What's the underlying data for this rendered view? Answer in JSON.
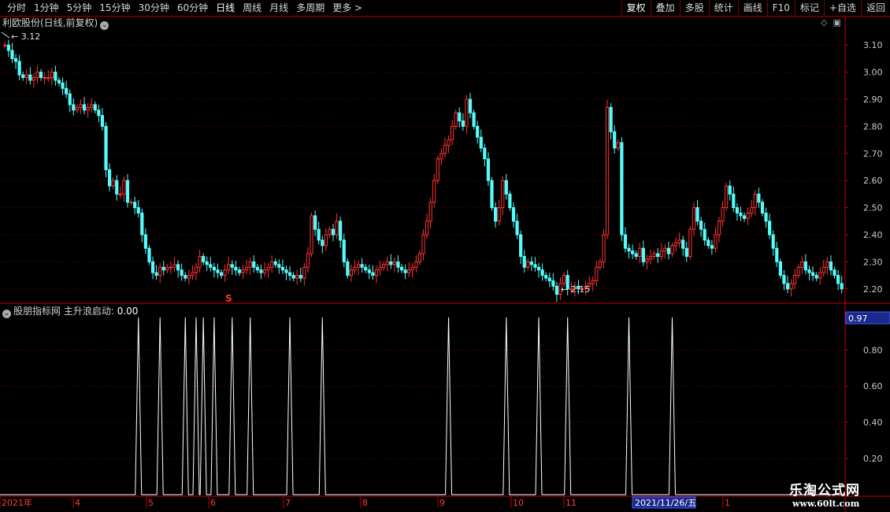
{
  "toolbar": {
    "periods": [
      "分时",
      "1分钟",
      "5分钟",
      "15分钟",
      "30分钟",
      "60分钟",
      "日线",
      "周线",
      "月线",
      "多周期",
      "更多 >"
    ],
    "active_period": "日线",
    "actions": [
      "复权",
      "叠加",
      "多股",
      "统计",
      "画线",
      "F10",
      "标记",
      "+自选",
      "返回"
    ]
  },
  "stock": {
    "title": "利欧股份(日线,前复权)"
  },
  "price_axis": {
    "labels": [
      "3.10",
      "3.00",
      "2.90",
      "2.80",
      "2.70",
      "2.60",
      "2.50",
      "2.40",
      "2.30",
      "2.20"
    ]
  },
  "annotations": {
    "high": "3.12",
    "low": "2.15",
    "signal": "S"
  },
  "indicator": {
    "title": "股朋指标网 主升浪启动:",
    "value": "0.00",
    "current": "0.97",
    "axis_labels": [
      "0.80",
      "0.60",
      "0.40",
      "0.20"
    ]
  },
  "date_axis": {
    "labels": [
      "2021年",
      "4",
      "5",
      "6",
      "7",
      "8",
      "9",
      "10",
      "11",
      "1"
    ],
    "cursor": "2021/11/26/五"
  },
  "watermark": {
    "name": "乐淘公式网",
    "url": "www.60lt.com"
  },
  "colors": {
    "up": "#ff3232",
    "down": "#54fcfc",
    "grid": "#7a0000",
    "axis": "#c00000",
    "line": "#ffffff"
  },
  "chart_data": {
    "type": "candlestick",
    "ylim": [
      2.15,
      3.15
    ],
    "y_ticks": [
      3.1,
      3.0,
      2.9,
      2.8,
      2.7,
      2.6,
      2.5,
      2.4,
      2.3,
      2.2
    ],
    "close": [
      3.1,
      3.08,
      3.05,
      3.04,
      2.99,
      2.98,
      2.99,
      2.97,
      2.98,
      3.0,
      2.98,
      2.98,
      2.98,
      3.0,
      2.97,
      2.96,
      2.94,
      2.92,
      2.88,
      2.86,
      2.87,
      2.88,
      2.86,
      2.87,
      2.88,
      2.86,
      2.84,
      2.8,
      2.64,
      2.58,
      2.6,
      2.55,
      2.55,
      2.6,
      2.52,
      2.52,
      2.5,
      2.48,
      2.4,
      2.35,
      2.3,
      2.26,
      2.25,
      2.28,
      2.27,
      2.28,
      2.28,
      2.29,
      2.27,
      2.25,
      2.24,
      2.25,
      2.26,
      2.28,
      2.32,
      2.3,
      2.29,
      2.28,
      2.27,
      2.26,
      2.25,
      2.27,
      2.29,
      2.28,
      2.27,
      2.26,
      2.27,
      2.28,
      2.3,
      2.28,
      2.27,
      2.26,
      2.27,
      2.28,
      2.3,
      2.29,
      2.28,
      2.27,
      2.26,
      2.25,
      2.24,
      2.25,
      2.24,
      2.28,
      2.33,
      2.47,
      2.42,
      2.38,
      2.36,
      2.4,
      2.42,
      2.4,
      2.45,
      2.38,
      2.3,
      2.25,
      2.27,
      2.28,
      2.29,
      2.28,
      2.27,
      2.26,
      2.25,
      2.27,
      2.28,
      2.29,
      2.3,
      2.29,
      2.3,
      2.28,
      2.27,
      2.26,
      2.27,
      2.28,
      2.3,
      2.33,
      2.4,
      2.45,
      2.52,
      2.6,
      2.68,
      2.7,
      2.73,
      2.75,
      2.8,
      2.85,
      2.82,
      2.8,
      2.9,
      2.85,
      2.8,
      2.76,
      2.72,
      2.68,
      2.6,
      2.5,
      2.45,
      2.5,
      2.6,
      2.55,
      2.5,
      2.45,
      2.4,
      2.32,
      2.28,
      2.3,
      2.29,
      2.28,
      2.27,
      2.25,
      2.24,
      2.23,
      2.21,
      2.18,
      2.22,
      2.25,
      2.2,
      2.2,
      2.21,
      2.2,
      2.2,
      2.21,
      2.22,
      2.23,
      2.28,
      2.3,
      2.4,
      2.87,
      2.78,
      2.72,
      2.74,
      2.4,
      2.35,
      2.34,
      2.33,
      2.32,
      2.35,
      2.3,
      2.31,
      2.32,
      2.33,
      2.32,
      2.34,
      2.35,
      2.33,
      2.36,
      2.37,
      2.38,
      2.35,
      2.32,
      2.42,
      2.5,
      2.45,
      2.42,
      2.38,
      2.36,
      2.35,
      2.4,
      2.45,
      2.5,
      2.58,
      2.55,
      2.5,
      2.48,
      2.47,
      2.46,
      2.48,
      2.5,
      2.55,
      2.52,
      2.48,
      2.45,
      2.4,
      2.35,
      2.3,
      2.25,
      2.22,
      2.2,
      2.22,
      2.25,
      2.28,
      2.3,
      2.27,
      2.26,
      2.25,
      2.24,
      2.26,
      2.28,
      2.3,
      2.27,
      2.25,
      2.22,
      2.2
    ],
    "annotated_high": 3.12,
    "annotated_low": 2.15,
    "indicator_spikes_index": [
      37,
      43,
      50,
      53,
      55,
      58,
      63,
      68,
      79,
      88,
      123,
      139,
      148,
      156,
      173,
      185
    ]
  }
}
